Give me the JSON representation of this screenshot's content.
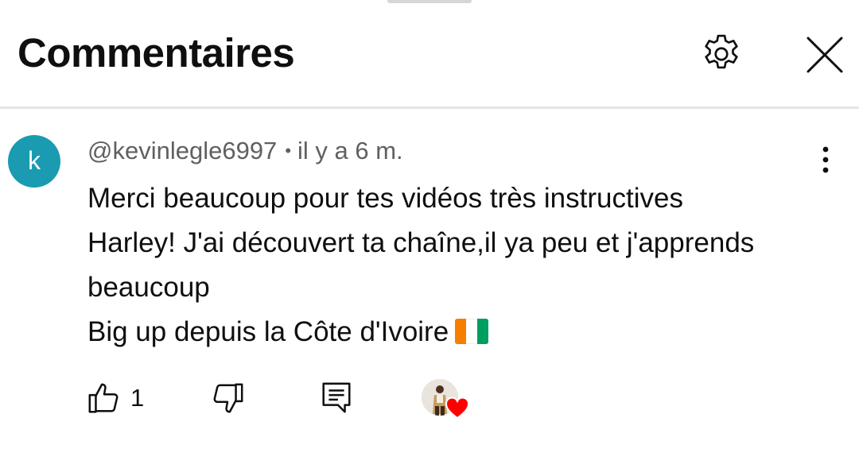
{
  "header": {
    "title": "Commentaires"
  },
  "comment": {
    "avatar_letter": "k",
    "author": "@kevinlegle6997",
    "separator": "•",
    "time": "il y a 6 m.",
    "lines": [
      "Merci beaucoup pour tes vidéos très instructives",
      "Harley! J'ai découvert ta chaîne,il ya peu et j'apprends",
      "beaucoup",
      "Big up depuis la Côte d'Ivoire"
    ],
    "flag_emoji": "côte-d'ivoire-flag",
    "like_count": "1"
  },
  "icons": {
    "settings": "gear-icon",
    "close": "close-icon",
    "more": "more-vertical-icon",
    "like": "thumbs-up-icon",
    "dislike": "thumbs-down-icon",
    "reply": "reply-comment-icon",
    "creator_heart": "heart-icon"
  },
  "colors": {
    "avatar_bg": "#1a9bb1",
    "meta_text": "#606060",
    "heart": "#ff0000",
    "flag_orange": "#f77f00",
    "flag_white": "#ffffff",
    "flag_green": "#009e60"
  }
}
